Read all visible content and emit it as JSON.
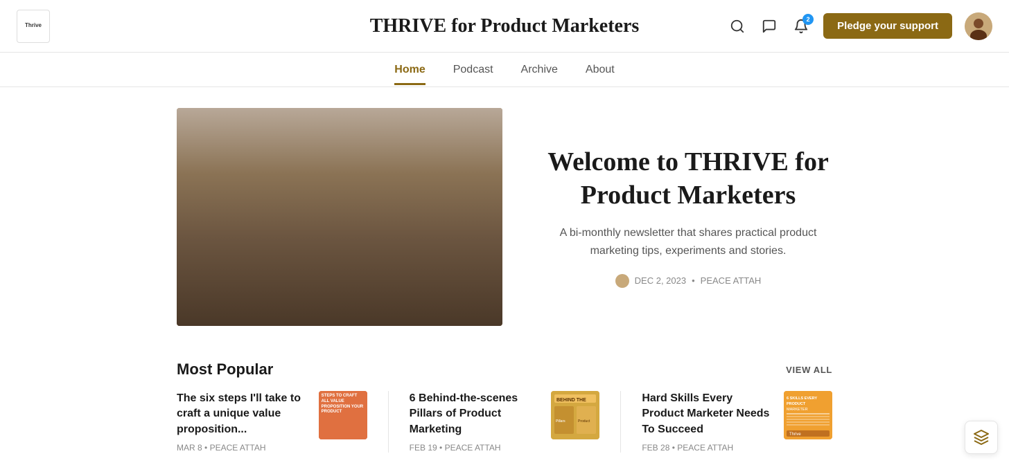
{
  "header": {
    "logo_text": "Thrive",
    "title": "THRIVE for Product Marketers",
    "notification_count": "2",
    "pledge_label": "Pledge your support"
  },
  "nav": {
    "items": [
      {
        "label": "Home",
        "active": true
      },
      {
        "label": "Podcast",
        "active": false
      },
      {
        "label": "Archive",
        "active": false
      },
      {
        "label": "About",
        "active": false
      }
    ]
  },
  "hero": {
    "title": "Welcome to THRIVE for Product Marketers",
    "subtitle": "A bi-monthly newsletter that shares practical product marketing tips, experiments and stories.",
    "date": "DEC 2, 2023",
    "author": "PEACE ATTAH"
  },
  "most_popular": {
    "section_label": "Most Popular",
    "view_all_label": "VIEW ALL",
    "articles": [
      {
        "title": "The six steps I'll take to craft a unique value proposition...",
        "date": "MAR 8",
        "author": "PEACE ATTAH"
      },
      {
        "title": "6 Behind-the-scenes Pillars of Product Marketing",
        "date": "FEB 19",
        "author": "PEACE ATTAH"
      },
      {
        "title": "Hard Skills Every Product Marketer Needs To Succeed",
        "date": "FEB 28",
        "author": "PEACE ATTAH"
      }
    ]
  },
  "icons": {
    "search": "🔍",
    "chat": "💬",
    "bell": "🔔",
    "grid": "⋯"
  }
}
